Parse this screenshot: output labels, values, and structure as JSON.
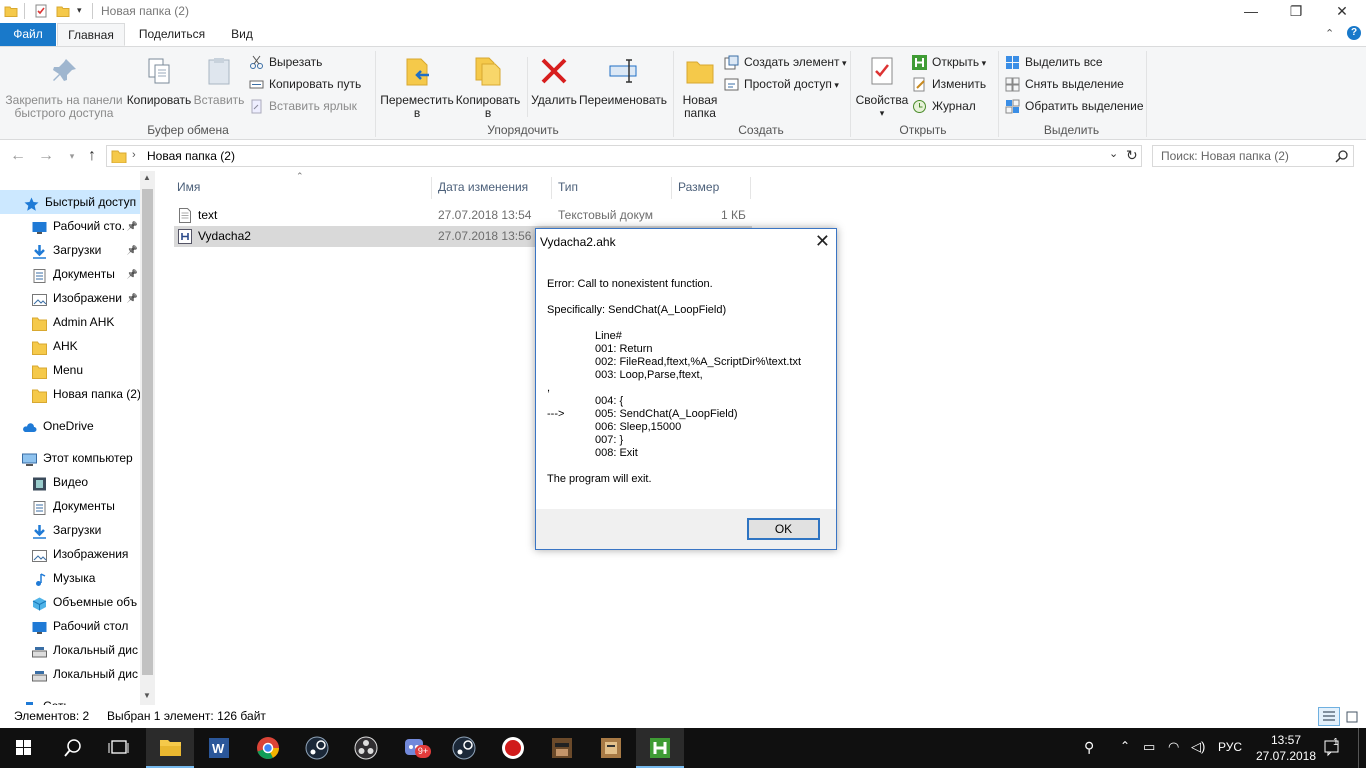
{
  "window": {
    "title": "Новая папка (2)",
    "controls": {
      "minimize": "—",
      "restore": "❐",
      "close": "✕"
    }
  },
  "ribbon_tabs": [
    {
      "label": "Файл"
    },
    {
      "label": "Главная"
    },
    {
      "label": "Поделиться"
    },
    {
      "label": "Вид"
    }
  ],
  "ribbon": {
    "clipboard": {
      "pin_label": "Закрепить на панели быстрого доступа",
      "pin_line1": "Закрепить на панели",
      "pin_line2": "быстрого доступа",
      "copy": "Копировать",
      "paste": "Вставить",
      "cut": "Вырезать",
      "copy_path": "Копировать путь",
      "paste_shortcut": "Вставить ярлык",
      "group": "Буфер обмена"
    },
    "organize": {
      "move_line1": "Переместить",
      "move_line2": "в",
      "copyto_line1": "Копировать",
      "copyto_line2": "в",
      "delete": "Удалить",
      "rename": "Переименовать",
      "group": "Упорядочить"
    },
    "create": {
      "new_folder_line1": "Новая",
      "new_folder_line2": "папка",
      "new_item": "Создать элемент",
      "easy_access": "Простой доступ",
      "group": "Создать"
    },
    "open": {
      "properties": "Свойства",
      "open": "Открыть",
      "edit": "Изменить",
      "history": "Журнал",
      "group": "Открыть"
    },
    "select": {
      "select_all": "Выделить все",
      "select_none": "Снять выделение",
      "invert": "Обратить выделение",
      "group": "Выделить"
    }
  },
  "address": {
    "path": "Новая папка (2)",
    "search_placeholder": "Поиск: Новая папка (2)"
  },
  "nav": {
    "items": [
      {
        "label": "Быстрый доступ",
        "icon": "star-icon",
        "pinned": false
      },
      {
        "label": "Рабочий сто.",
        "icon": "desktop-icon",
        "pinned": true
      },
      {
        "label": "Загрузки",
        "icon": "download-icon",
        "pinned": true
      },
      {
        "label": "Документы",
        "icon": "documents-icon",
        "pinned": true
      },
      {
        "label": "Изображени",
        "icon": "pictures-icon",
        "pinned": true
      },
      {
        "label": "Admin AHK",
        "icon": "folder-icon",
        "pinned": false
      },
      {
        "label": "AHK",
        "icon": "folder-icon",
        "pinned": false
      },
      {
        "label": "Menu",
        "icon": "folder-icon",
        "pinned": false
      },
      {
        "label": "Новая папка (2)",
        "icon": "folder-icon",
        "pinned": false
      },
      {
        "label": "OneDrive",
        "icon": "cloud-icon",
        "pinned": false
      },
      {
        "label": "Этот компьютер",
        "icon": "computer-icon",
        "pinned": false
      },
      {
        "label": "Видео",
        "icon": "video-icon",
        "pinned": false
      },
      {
        "label": "Документы",
        "icon": "documents-icon",
        "pinned": false
      },
      {
        "label": "Загрузки",
        "icon": "download-icon",
        "pinned": false
      },
      {
        "label": "Изображения",
        "icon": "pictures-icon",
        "pinned": false
      },
      {
        "label": "Музыка",
        "icon": "music-icon",
        "pinned": false
      },
      {
        "label": "Объемные объ",
        "icon": "3d-objects-icon",
        "pinned": false
      },
      {
        "label": "Рабочий стол",
        "icon": "desktop-icon",
        "pinned": false
      },
      {
        "label": "Локальный дис",
        "icon": "drive-icon",
        "pinned": false
      },
      {
        "label": "Локальный дис",
        "icon": "drive-icon",
        "pinned": false
      },
      {
        "label": "Сеть",
        "icon": "network-icon",
        "pinned": false
      }
    ]
  },
  "columns": {
    "name": "Имя",
    "modified": "Дата изменения",
    "type": "Тип",
    "size": "Размер"
  },
  "files": [
    {
      "name": "text",
      "modified": "27.07.2018 13:54",
      "type": "Текстовый докум",
      "size": "1 КБ",
      "icon": "text-file-icon"
    },
    {
      "name": "Vydacha2",
      "modified": "27.07.2018 13:56",
      "type": "",
      "size": "",
      "icon": "ahk-script-icon"
    }
  ],
  "status": {
    "count": "Элементов: 2",
    "selection": "Выбран 1 элемент: 126 байт"
  },
  "dialog": {
    "title": "Vydacha2.ahk",
    "error": "Error:  Call to nonexistent function.",
    "specifically": "Specifically: SendChat(A_LoopField)",
    "lines": [
      {
        "marker": "",
        "text": "Line#"
      },
      {
        "marker": "",
        "text": "001: Return"
      },
      {
        "marker": "",
        "text": "002: FileRead,ftext,%A_ScriptDir%\\text.txt"
      },
      {
        "marker": "",
        "text": "003: Loop,Parse,ftext,"
      },
      {
        "marker": ",",
        "text": ""
      },
      {
        "marker": "",
        "text": "004: {"
      },
      {
        "marker": "--->",
        "text": "005: SendChat(A_LoopField)"
      },
      {
        "marker": "",
        "text": "006: Sleep,15000"
      },
      {
        "marker": "",
        "text": "007: }"
      },
      {
        "marker": "",
        "text": "008: Exit"
      }
    ],
    "footer_msg": "The program will exit.",
    "ok": "OK"
  },
  "taskbar": {
    "lang": "РУС",
    "time": "13:57",
    "date": "27.07.2018",
    "notification_count": "1",
    "steam_badge": "9+"
  },
  "colors": {
    "accent": "#1979ca",
    "selection": "#cce8ff",
    "taskbar": "#101010"
  }
}
